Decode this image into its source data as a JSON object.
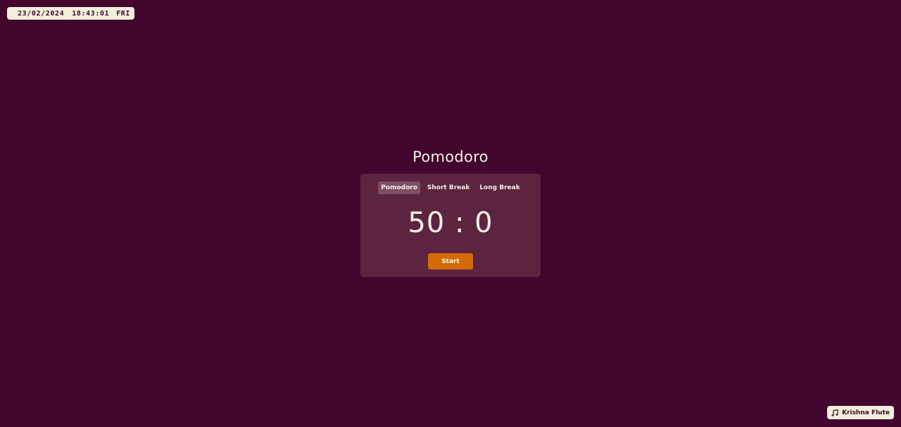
{
  "clock": {
    "date": "23/02/2024",
    "time": "18:43:01",
    "day": "FRI"
  },
  "title": "Pomodoro",
  "tabs": [
    {
      "label": "Pomodoro",
      "active": true
    },
    {
      "label": "Short Break",
      "active": false
    },
    {
      "label": "Long Break",
      "active": false
    }
  ],
  "timer": {
    "display": "50 : 0"
  },
  "start_label": "Start",
  "music": {
    "icon": "music-note-icon",
    "label": "Krishna Flute"
  },
  "colors": {
    "background": "#42052e",
    "card": "#5d2440",
    "accent": "#d26b07",
    "pill": "#f3eddc"
  }
}
